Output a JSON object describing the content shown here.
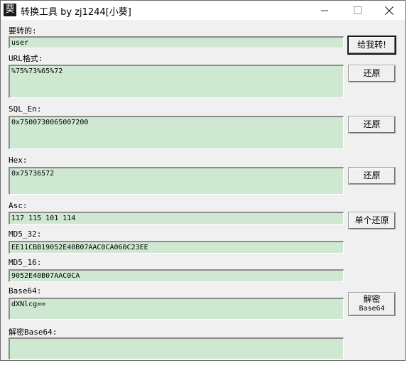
{
  "window": {
    "title": "转换工具 by zj1244[小葵]",
    "app_icon_glyph": "葵"
  },
  "fields": {
    "input": {
      "label": "要转的:",
      "value": "user"
    },
    "url": {
      "label": "URL格式:",
      "value": "%75%73%65%72"
    },
    "sql_en": {
      "label": "SQL_En:",
      "value": "0x7500730065007200"
    },
    "hex": {
      "label": "Hex:",
      "value": "0x75736572"
    },
    "asc": {
      "label": "Asc:",
      "value": "117 115 101 114"
    },
    "md5_32": {
      "label": "MD5_32:",
      "value": "EE11CBB19052E40B07AAC0CA060C23EE"
    },
    "md5_16": {
      "label": "MD5_16:",
      "value": "9052E40B07AAC0CA"
    },
    "base64": {
      "label": "Base64:",
      "value": "dXNlcg=="
    },
    "decode_base64": {
      "label": "解密Base64:",
      "value": ""
    }
  },
  "buttons": {
    "convert": "给我转!",
    "restore_url": "还原",
    "restore_sql": "还原",
    "restore_hex": "还原",
    "restore_asc": "单个还原",
    "decode_line1": "解密",
    "decode_line2": "Base64"
  },
  "colors": {
    "field_bg": "#cfe8d1",
    "window_bg": "#f0f0f0"
  }
}
